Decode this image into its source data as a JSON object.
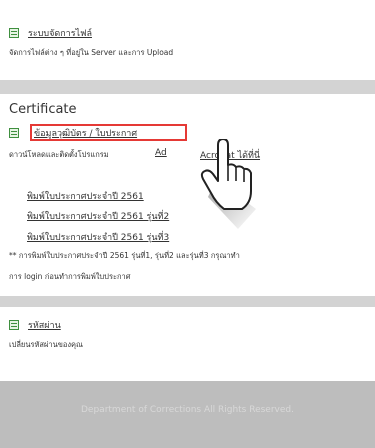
{
  "file_system": {
    "title": "ระบบจัดการไฟล์",
    "description": "จัดการไฟล์ต่าง ๆ ที่อยู่ใน Server และการ Upload"
  },
  "certificate": {
    "heading": "Certificate",
    "info_link": "ข้อมูลวุฒิบัตร / ใบประกาศ",
    "download_prefix": "ดาวน์โหลดและติดตั้งโปรแกรม",
    "download_link_1": "Ad",
    "download_link_2": "Acrobat ได้ที่นี่",
    "print_links": [
      "พิมพ์ใบประกาศประจำปี 2561",
      "พิมพ์ใบประกาศประจำปี 2561 รุ่นที่2",
      "พิมพ์ใบประกาศประจำปี 2561 รุ่นที่3"
    ],
    "note_line1": "** การพิมพ์ใบประกาศประจำปี 2561 รุ่นที่1, รุ่นที่2 และรุ่นที่3 กรุณาทำ",
    "note_line2": "การ login ก่อนทำการพิมพ์ใบประกาศ"
  },
  "password": {
    "title": "รหัสผ่าน",
    "description": "เปลี่ยนรหัสผ่านของคุณ"
  },
  "footer": {
    "text": "Department of Corrections All Rights Reserved."
  },
  "icons": {
    "document": "document-icon",
    "cursor": "hand-pointer-icon"
  },
  "colors": {
    "highlight": "#e53935",
    "icon": "#3f8f3f"
  }
}
